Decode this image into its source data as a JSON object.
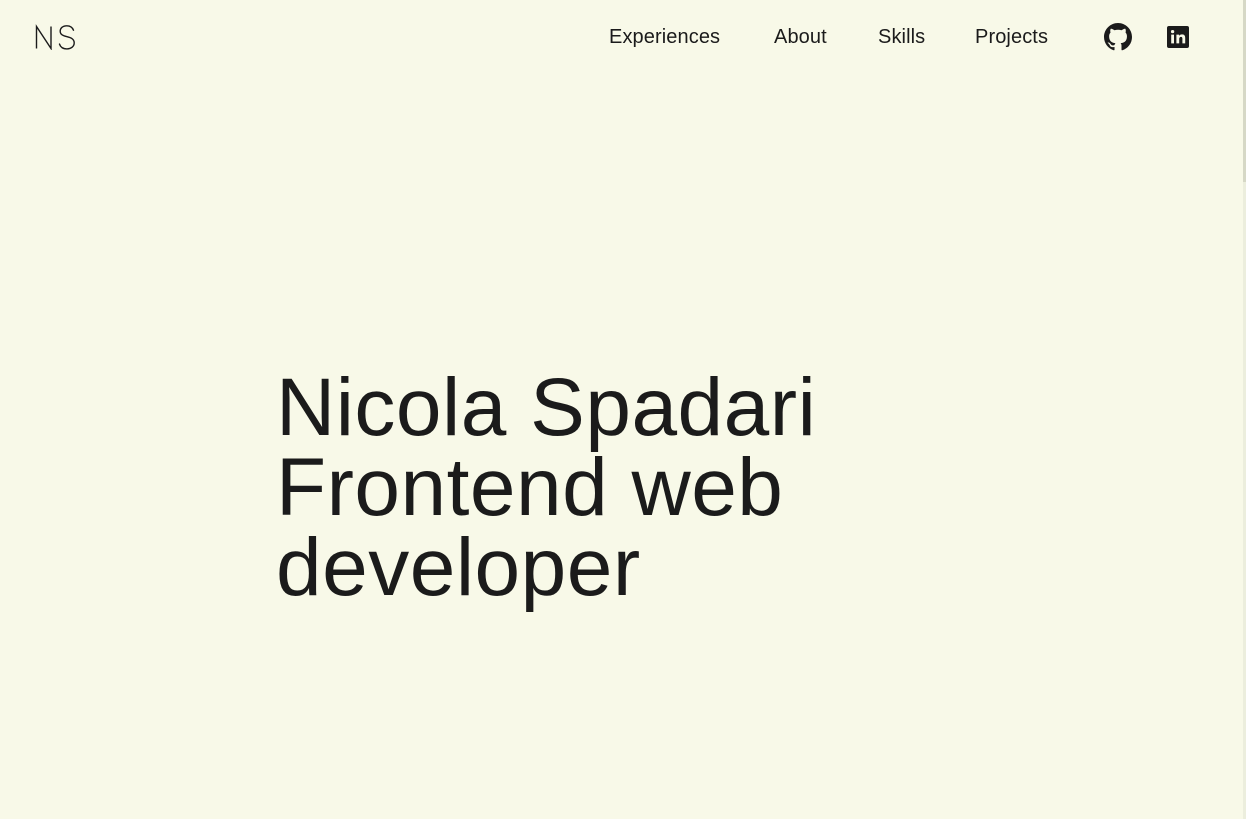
{
  "header": {
    "logo": {
      "text": "NS"
    },
    "nav": [
      {
        "label": "Experiences"
      },
      {
        "label": "About"
      },
      {
        "label": "Skills"
      },
      {
        "label": "Projects"
      }
    ],
    "social": [
      {
        "icon": "github-icon"
      },
      {
        "icon": "linkedin-icon"
      }
    ]
  },
  "hero": {
    "name": "Nicola Spadari",
    "role_line_1": "Frontend web",
    "role_line_2": "developer"
  },
  "colors": {
    "background": "#f8f9e8",
    "text": "#1b1b1b"
  }
}
